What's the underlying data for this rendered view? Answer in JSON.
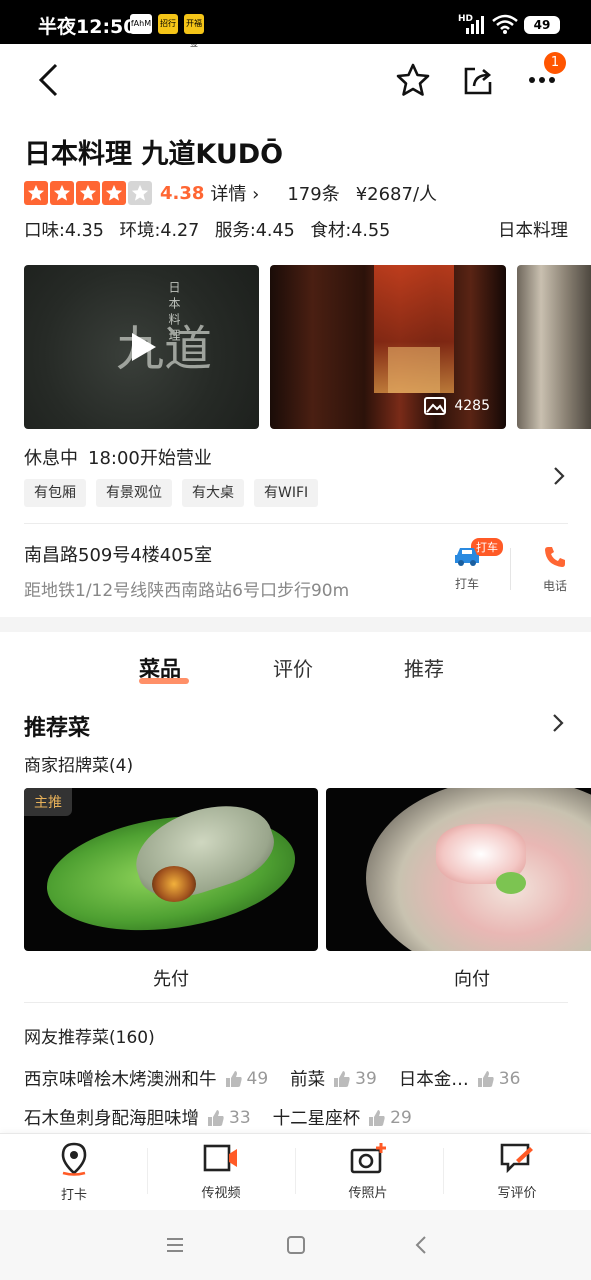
{
  "status_bar": {
    "time": "半夜12:50",
    "apps": [
      "fAhM",
      "招行",
      "开福签"
    ],
    "network": "HD",
    "battery": "49"
  },
  "nav": {
    "notification_count": "1"
  },
  "shop": {
    "name": "日本料理 九道KUDŌ",
    "rating_stars": 4,
    "score": "4.38",
    "detail_link": "详情",
    "review_count": "179条",
    "price": "¥2687/人",
    "sub_scores": {
      "taste": "口味:4.35",
      "environment": "环境:4.27",
      "service": "服务:4.45",
      "ingredients": "食材:4.55"
    },
    "cuisine": "日本料理",
    "status": "休息中",
    "hours": "18:00开始营业",
    "tags": [
      "有包厢",
      "有景观位",
      "有大桌",
      "有WIFI"
    ],
    "address": "南昌路509号4楼405室",
    "metro": "距地铁1/12号线陕西南路站6号口步行90m"
  },
  "gallery": {
    "video_title_vertical": "日本料理",
    "video_logo_text": "九道",
    "photo_count": "4285"
  },
  "actions": {
    "taxi_label": "打车",
    "taxi_badge": "打车",
    "phone_label": "电话"
  },
  "tabs": [
    {
      "label": "菜品",
      "active": true
    },
    {
      "label": "评价",
      "active": false
    },
    {
      "label": "推荐",
      "active": false
    }
  ],
  "recommended": {
    "title": "推荐菜",
    "signature_label": "商家招牌菜(4)",
    "main_tag": "主推",
    "dishes": [
      "先付",
      "向付"
    ],
    "user_title": "网友推荐菜(160)",
    "user_items_row1": [
      {
        "name": "西京味噌桧木烤澳洲和牛",
        "likes": "49"
      },
      {
        "name": "前菜",
        "likes": "39"
      },
      {
        "name": "日本金…",
        "likes": "36"
      }
    ],
    "user_items_row2": [
      {
        "name": "石木鱼刺身配海胆味增",
        "likes": "33"
      },
      {
        "name": "十二星座杯",
        "likes": "29"
      }
    ]
  },
  "toolbar": {
    "checkin": "打卡",
    "video": "传视频",
    "photo": "传照片",
    "review": "写评价"
  },
  "colors": {
    "accent": "#ff6633",
    "badge": "#ff5500"
  }
}
